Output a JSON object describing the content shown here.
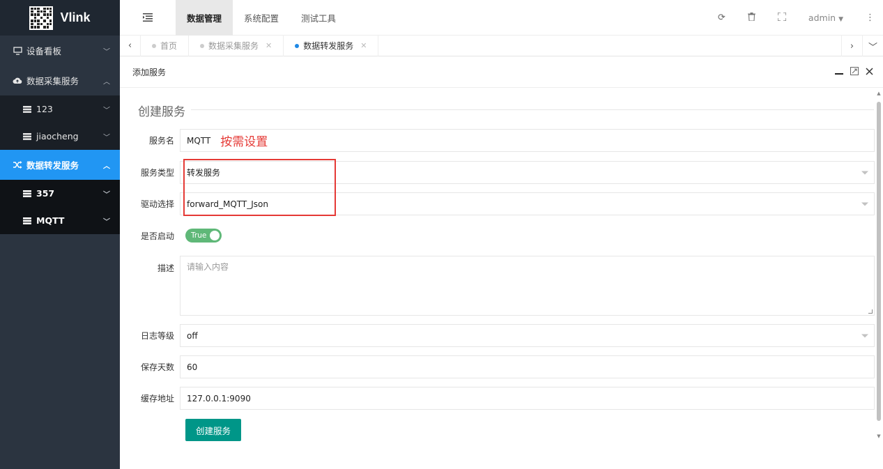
{
  "app": {
    "name": "Vlink"
  },
  "sidebar": {
    "items": [
      {
        "label": "设备看板",
        "icon": "monitor-icon"
      },
      {
        "label": "数据采集服务",
        "icon": "cloud-icon"
      },
      {
        "label": "123",
        "icon": "server-icon"
      },
      {
        "label": "jiaocheng",
        "icon": "server-icon"
      },
      {
        "label": "数据转发服务",
        "icon": "shuffle-icon"
      },
      {
        "label": "357",
        "icon": "server-icon"
      },
      {
        "label": "MQTT",
        "icon": "server-icon"
      }
    ]
  },
  "header": {
    "tabs": [
      {
        "label": "数据管理"
      },
      {
        "label": "系统配置"
      },
      {
        "label": "测试工具"
      }
    ],
    "user": "admin"
  },
  "page_tabs": [
    {
      "label": "首页"
    },
    {
      "label": "数据采集服务"
    },
    {
      "label": "数据转发服务"
    }
  ],
  "panel": {
    "title": "添加服务"
  },
  "form": {
    "legend": "创建服务",
    "service_name": {
      "label": "服务名",
      "value": "MQTT",
      "note": "按需设置"
    },
    "service_type": {
      "label": "服务类型",
      "value": "转发服务"
    },
    "driver": {
      "label": "驱动选择",
      "value": "forward_MQTT_Json"
    },
    "enabled": {
      "label": "是否启动",
      "value": "True"
    },
    "description": {
      "label": "描述",
      "placeholder": "请输入内容"
    },
    "log_level": {
      "label": "日志等级",
      "value": "off"
    },
    "retention": {
      "label": "保存天数",
      "value": "60"
    },
    "cache": {
      "label": "缓存地址",
      "value": "127.0.0.1:9090"
    },
    "submit": "创建服务"
  },
  "colors": {
    "sidebar_bg": "#2b3440",
    "active_blue": "#2196f3",
    "primary_teal": "#009688",
    "switch_green": "#5fb878",
    "annotation_red": "#e53935"
  }
}
